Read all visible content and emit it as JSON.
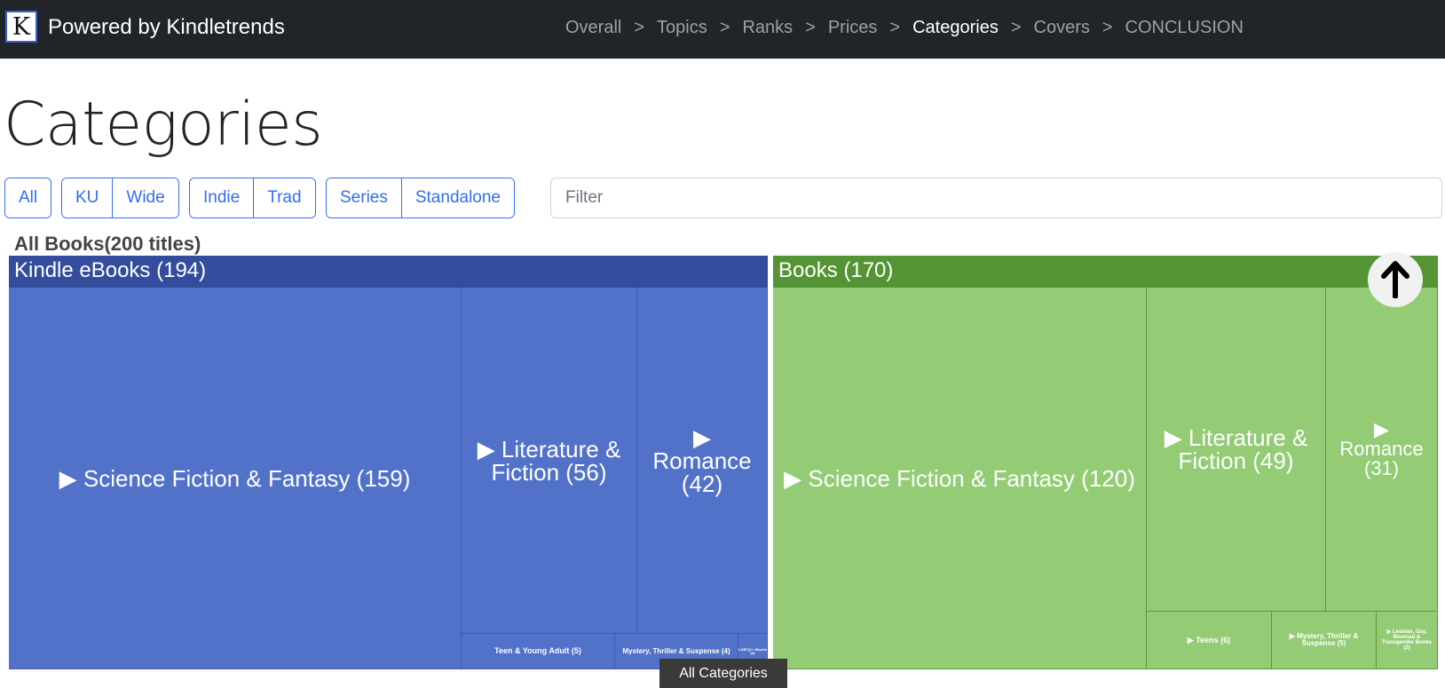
{
  "navbar": {
    "logo_letter": "K",
    "brand": "Powered by Kindletrends",
    "separator": ">",
    "items": [
      {
        "label": "Overall",
        "active": false
      },
      {
        "label": "Topics",
        "active": false
      },
      {
        "label": "Ranks",
        "active": false
      },
      {
        "label": "Prices",
        "active": false
      },
      {
        "label": "Categories",
        "active": true
      },
      {
        "label": "Covers",
        "active": false
      },
      {
        "label": "CONCLUSION",
        "active": false
      }
    ]
  },
  "page": {
    "title": "Categories"
  },
  "filters": {
    "all": "All",
    "ku": "KU",
    "wide": "Wide",
    "indie": "Indie",
    "trad": "Trad",
    "series": "Series",
    "standalone": "Standalone",
    "search_placeholder": "Filter",
    "search_value": ""
  },
  "treemap": {
    "root_label": "All Books(200 titles)",
    "groups": [
      {
        "label": "Kindle eBooks (194)",
        "color": "#334d9c",
        "cells": [
          {
            "label": "▶ Science Fiction & Fantasy (159)"
          },
          {
            "label": "▶ Literature & Fiction (56)"
          },
          {
            "label": "▶ Romance (42)"
          },
          {
            "label": "Teen & Young Adult (5)"
          },
          {
            "label": "Mystery, Thriller & Suspense (4)"
          },
          {
            "label": "LGBTQ+ eBooks (3)"
          }
        ]
      },
      {
        "label": "Books (170)",
        "color": "#549434",
        "cells": [
          {
            "label": "▶ Science Fiction & Fantasy (120)"
          },
          {
            "label": "▶ Literature & Fiction (49)"
          },
          {
            "label": "▶ Romance (31)"
          },
          {
            "label": "▶ Teens (6)"
          },
          {
            "label": "▶ Mystery, Thriller & Suspense (5)"
          },
          {
            "label": "▶ Lesbian, Gay, Bisexual & Transgender Books (3)"
          }
        ]
      }
    ]
  },
  "tooltip": "All Categories",
  "icons": {
    "scroll_top": "arrow-up-icon"
  }
}
